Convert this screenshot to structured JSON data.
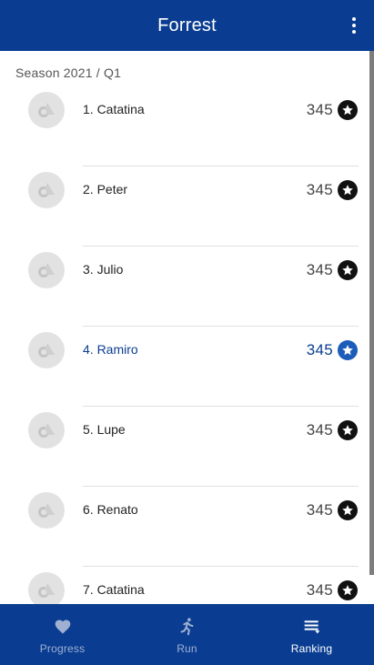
{
  "app_bar": {
    "title": "Forrest"
  },
  "section_header": "Season 2021 / Q1",
  "ranking": [
    {
      "name": "1. Catatina",
      "score": "345",
      "highlighted": false
    },
    {
      "name": "2. Peter",
      "score": "345",
      "highlighted": false
    },
    {
      "name": "3. Julio",
      "score": "345",
      "highlighted": false
    },
    {
      "name": "4. Ramiro",
      "score": "345",
      "highlighted": true
    },
    {
      "name": "5. Lupe",
      "score": "345",
      "highlighted": false
    },
    {
      "name": "6. Renato",
      "score": "345",
      "highlighted": false
    },
    {
      "name": "7. Catatina",
      "score": "345",
      "highlighted": false
    }
  ],
  "bottom_nav": [
    {
      "label": "Progress",
      "icon": "heart-icon",
      "active": false
    },
    {
      "label": "Run",
      "icon": "run-icon",
      "active": false
    },
    {
      "label": "Ranking",
      "icon": "ranking-icon",
      "active": true
    }
  ],
  "colors": {
    "primary": "#0a3d91",
    "highlight": "#1c5db9",
    "inactive_nav": "#9fb0d3"
  }
}
